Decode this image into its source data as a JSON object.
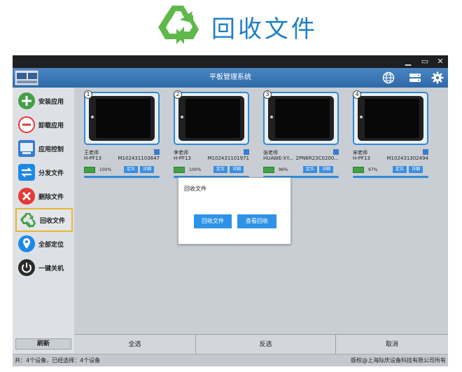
{
  "banner": {
    "title": "回收文件",
    "icon": "recycle-icon"
  },
  "window": {
    "minimize_glyph": "▁",
    "maximize_glyph": "▭",
    "close_glyph": "✕"
  },
  "header": {
    "title": "平板管理系统",
    "icons": [
      "globe-icon",
      "server-icon",
      "gear-icon"
    ]
  },
  "sidebar": {
    "items": [
      {
        "label": "安装应用",
        "icon": "install-icon",
        "color": "#43a047"
      },
      {
        "label": "卸载应用",
        "icon": "uninstall-icon",
        "color": "#e53935"
      },
      {
        "label": "应用控制",
        "icon": "app-control-icon",
        "color": "#3a7bd0"
      },
      {
        "label": "分发文件",
        "icon": "distribute-icon",
        "color": "#1e88e5"
      },
      {
        "label": "删除文件",
        "icon": "delete-icon",
        "color": "#e53935"
      },
      {
        "label": "回收文件",
        "icon": "recycle-icon",
        "color": "#43a047"
      },
      {
        "label": "全部定位",
        "icon": "location-icon",
        "color": "#1e88e5"
      },
      {
        "label": "一键关机",
        "icon": "power-icon",
        "color": "#333333"
      }
    ],
    "refresh_label": "刷新"
  },
  "devices": [
    {
      "num": "1",
      "user": "王老师",
      "model": "H-PF13",
      "serial": "M102431103647",
      "battery": "100%",
      "locate": "定位",
      "detail": "详细"
    },
    {
      "num": "2",
      "user": "李老师",
      "model": "H-PF13",
      "serial": "M102431101971",
      "battery": "100%",
      "locate": "定位",
      "detail": "详细"
    },
    {
      "num": "3",
      "user": "张老师",
      "model": "HUAWE-XY...",
      "serial": "2PN6R23C0200...",
      "battery": "96%",
      "locate": "定位",
      "detail": "详细"
    },
    {
      "num": "4",
      "user": "宋老师",
      "model": "H-PF13",
      "serial": "M102431302494",
      "battery": "97%",
      "locate": "定位",
      "detail": "详细"
    }
  ],
  "dialog": {
    "title": "回收文件",
    "primary_label": "回收文件",
    "secondary_label": "查看回收"
  },
  "bottom": {
    "select_all": "全选",
    "invert": "反选",
    "cancel": "取消"
  },
  "status": {
    "left": "共：4个设备，已经选择：4个设备",
    "right": "版权@上海际庆设备科技有限公司所有"
  },
  "colors": {
    "accent": "#2d8ad8",
    "header": "#3a78b8",
    "selected_border": "#e7b731"
  }
}
